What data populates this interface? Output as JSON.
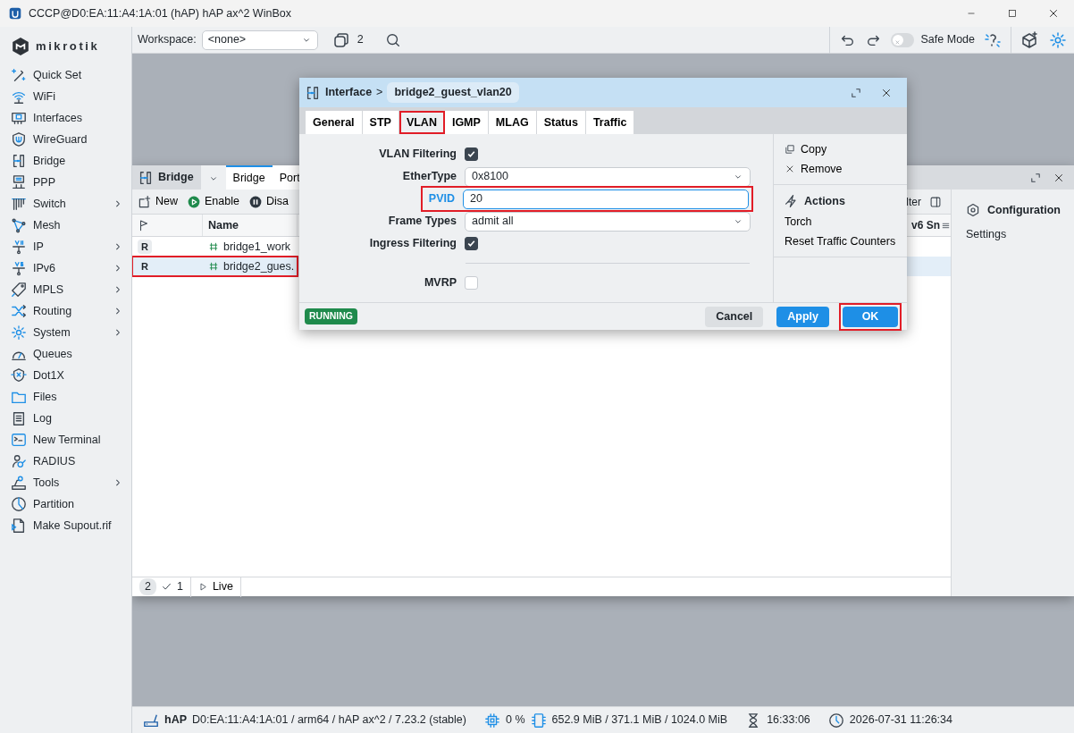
{
  "window": {
    "title": "CCCP@D0:EA:11:A4:1A:01 (hAP) hAP ax^2 WinBox"
  },
  "sidebar": {
    "logo": "mikrotik",
    "items": [
      {
        "label": "Quick Set",
        "has_submenu": false
      },
      {
        "label": "WiFi",
        "has_submenu": false
      },
      {
        "label": "Interfaces",
        "has_submenu": false
      },
      {
        "label": "WireGuard",
        "has_submenu": false
      },
      {
        "label": "Bridge",
        "has_submenu": false
      },
      {
        "label": "PPP",
        "has_submenu": false
      },
      {
        "label": "Switch",
        "has_submenu": true
      },
      {
        "label": "Mesh",
        "has_submenu": false
      },
      {
        "label": "IP",
        "has_submenu": true
      },
      {
        "label": "IPv6",
        "has_submenu": true
      },
      {
        "label": "MPLS",
        "has_submenu": true
      },
      {
        "label": "Routing",
        "has_submenu": true
      },
      {
        "label": "System",
        "has_submenu": true
      },
      {
        "label": "Queues",
        "has_submenu": false
      },
      {
        "label": "Dot1X",
        "has_submenu": false
      },
      {
        "label": "Files",
        "has_submenu": false
      },
      {
        "label": "Log",
        "has_submenu": false
      },
      {
        "label": "New Terminal",
        "has_submenu": false
      },
      {
        "label": "RADIUS",
        "has_submenu": false
      },
      {
        "label": "Tools",
        "has_submenu": true
      },
      {
        "label": "Partition",
        "has_submenu": false
      },
      {
        "label": "Make Supout.rif",
        "has_submenu": false
      }
    ]
  },
  "toolbar": {
    "workspace_label": "Workspace:",
    "workspace_value": "<none>",
    "window_count": "2",
    "safe_mode": {
      "label": "Safe Mode",
      "on": false
    }
  },
  "bridge_window": {
    "title": "Bridge",
    "tabs": [
      {
        "label": "Bridge",
        "selected": true
      },
      {
        "label": "Port",
        "selected": false
      }
    ],
    "actions": [
      "New",
      "Enable",
      "Disa"
    ],
    "filter_fragment": "lter",
    "columns": [
      "Name"
    ],
    "cut_column": "v6 Sn",
    "rows": [
      {
        "flag": "R",
        "name": "bridge1_work",
        "selected": false,
        "highlighted": false
      },
      {
        "flag": "R",
        "name": "bridge2_gues.",
        "selected": true,
        "highlighted": true
      }
    ],
    "side_panel": {
      "title": "Configuration",
      "items": [
        "Settings"
      ]
    },
    "footer": {
      "count": "2",
      "checked": "1",
      "live": "Live"
    }
  },
  "dialog": {
    "breadcrumb": "Interface",
    "separator": ">",
    "name": "bridge2_guest_vlan20",
    "tabs": [
      {
        "label": "General",
        "selected": false,
        "highlighted": false
      },
      {
        "label": "STP",
        "selected": false,
        "highlighted": false
      },
      {
        "label": "VLAN",
        "selected": true,
        "highlighted": true
      },
      {
        "label": "IGMP",
        "selected": false,
        "highlighted": false
      },
      {
        "label": "MLAG",
        "selected": false,
        "highlighted": false
      },
      {
        "label": "Status",
        "selected": false,
        "highlighted": false
      },
      {
        "label": "Traffic",
        "selected": false,
        "highlighted": false
      }
    ],
    "fields": [
      {
        "kind": "checkbox",
        "label": "VLAN Filtering",
        "checked": true,
        "highlighted": false
      },
      {
        "kind": "select",
        "label": "EtherType",
        "value": "0x8100",
        "highlighted": false
      },
      {
        "kind": "input",
        "label": "PVID",
        "value": "20",
        "focused": true,
        "highlighted": true
      },
      {
        "kind": "select",
        "label": "Frame Types",
        "value": "admit all",
        "highlighted": false
      },
      {
        "kind": "checkbox",
        "label": "Ingress Filtering",
        "checked": true,
        "highlighted": false
      },
      {
        "kind": "divider"
      },
      {
        "kind": "checkbox",
        "label": "MVRP",
        "checked": false,
        "highlighted": false
      }
    ],
    "item_actions": [
      "Copy",
      "Remove"
    ],
    "actions_title": "Actions",
    "action_items": [
      "Torch",
      "Reset Traffic Counters"
    ],
    "status": "RUNNING",
    "buttons": [
      {
        "label": "Cancel",
        "kind": "secondary",
        "highlighted": false
      },
      {
        "label": "Apply",
        "kind": "primary",
        "highlighted": false
      },
      {
        "label": "OK",
        "kind": "primary",
        "highlighted": true
      }
    ]
  },
  "status_bar": {
    "device": "hAP",
    "details": "D0:EA:11:A4:1A:01 / arm64 / hAP ax^2 / 7.23.2 (stable)",
    "cpu": "0 %",
    "memory": "652.9 MiB / 371.1 MiB / 1024.0 MiB",
    "uptime": "16:33:06",
    "clock": "2026-07-31 11:26:34"
  }
}
